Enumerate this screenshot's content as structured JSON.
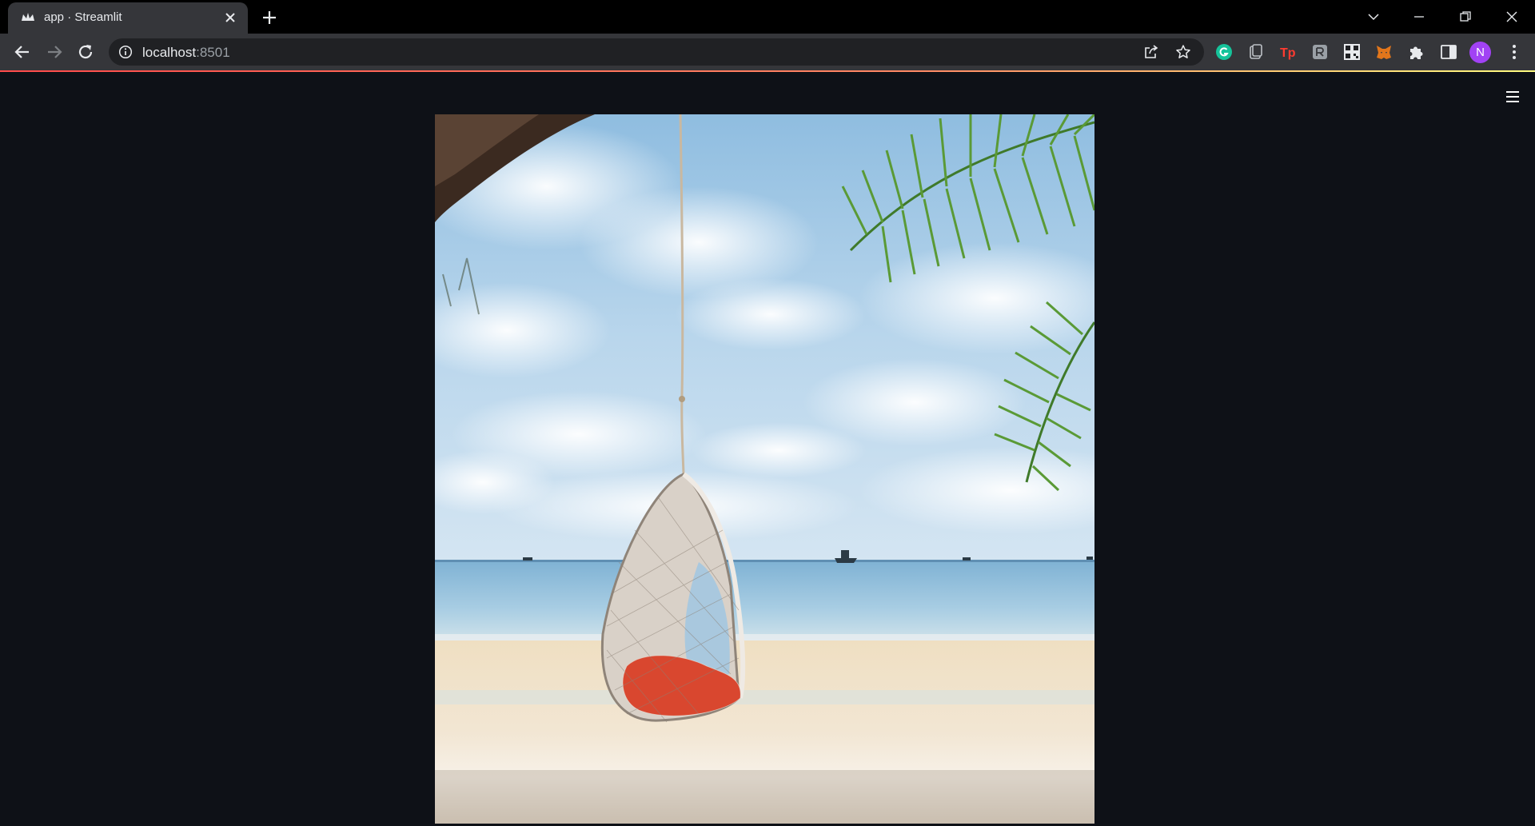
{
  "browser": {
    "tab_title": "app · Streamlit",
    "url_host": "localhost",
    "url_port": ":8501",
    "profile_initial": "N",
    "icons": {
      "favicon": "streamlit-crown-icon",
      "tab_close": "close-icon",
      "new_tab": "plus-icon",
      "tab_search": "chevron-down-icon",
      "minimize": "minimize-icon",
      "restore": "restore-icon",
      "close_window": "close-icon",
      "back": "arrow-left-icon",
      "forward": "arrow-right-icon",
      "reload": "reload-icon",
      "site_info": "info-icon",
      "share": "share-icon",
      "bookmark": "star-icon",
      "extensions": [
        "grammarly-icon",
        "clipboard-icon",
        "tp-icon",
        "reader-icon",
        "qr-code-icon",
        "metamask-icon",
        "puzzle-icon"
      ],
      "side_panel": "side-panel-icon",
      "menu": "vertical-dots-icon"
    },
    "colors": {
      "loading_bar_start": "#ff4b4b",
      "loading_bar_end": "#fffd80"
    }
  },
  "app": {
    "background": "#0e1117",
    "main_menu_icon": "hamburger-menu-icon",
    "image": {
      "subject": "hanging wicker egg chair on tropical beach",
      "caption": ""
    }
  }
}
